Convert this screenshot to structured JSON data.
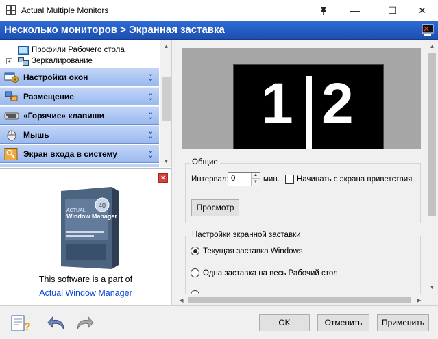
{
  "window": {
    "title": "Actual Multiple Monitors",
    "pin_glyph": "⚲",
    "minimize_glyph": "—",
    "maximize_glyph": "☐",
    "close_glyph": "✕"
  },
  "header": {
    "title": "Несколько мониторов > Экранная заставка",
    "icon": "monitor-settings-icon"
  },
  "tree": {
    "items": [
      {
        "label": "Профили Рабочего стола",
        "icon": "desktop-profile-icon"
      },
      {
        "label": "Зеркалирование",
        "icon": "mirroring-icon",
        "expander": "+"
      }
    ]
  },
  "accordion": {
    "items": [
      {
        "label": "Настройки окон",
        "icon": "window-settings-icon",
        "chevron": "⌄⌄"
      },
      {
        "label": "Размещение",
        "icon": "placement-icon",
        "chevron": "⌄⌄"
      },
      {
        "label": "«Горячие» клавиши",
        "icon": "keyboard-icon",
        "chevron": "⌄⌄"
      },
      {
        "label": "Мышь",
        "icon": "mouse-icon",
        "chevron": "⌄⌄"
      },
      {
        "label": "Экран входа в систему",
        "icon": "logon-key-icon",
        "chevron": "⌄⌄"
      }
    ]
  },
  "ad": {
    "close_glyph": "×",
    "text": "This software is a part of",
    "link": "Actual Window Manager",
    "box_brand": "ACTUAL",
    "box_title": "Window Manager",
    "box_badge": "40"
  },
  "preview": {
    "left_number": "1",
    "right_number": "2"
  },
  "general": {
    "title": "Общие",
    "interval_label": "Интервал:",
    "interval_value": "0",
    "interval_unit": "мин.",
    "welcome_checkbox_label": "Начинать с экрана приветствия",
    "welcome_checked": false,
    "preview_button": "Просмотр"
  },
  "screensaver": {
    "title": "Настройки экранной заставки",
    "options": [
      {
        "label": "Текущая заставка Windows",
        "selected": true
      },
      {
        "label": "Одна заставка на весь Рабочий стол",
        "selected": false
      },
      {
        "label": "",
        "selected": false
      }
    ]
  },
  "footer": {
    "ok": "OK",
    "cancel": "Отменить",
    "apply": "Применить",
    "icons": [
      "help-icon",
      "undo-icon",
      "redo-icon"
    ]
  },
  "colors": {
    "header_bg": "#2563c8",
    "accordion_bg": "#aec6f2",
    "link": "#0645d6",
    "close_red": "#d8413a"
  }
}
